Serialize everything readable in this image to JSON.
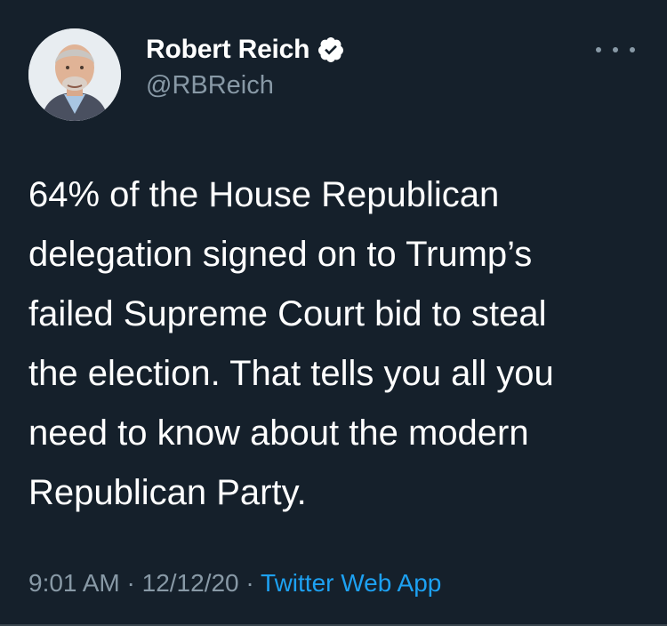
{
  "tweet": {
    "author": {
      "display_name": "Robert Reich",
      "handle": "@RBReich",
      "verified": true,
      "verified_icon": "verified-badge-icon",
      "avatar_icon": "avatar-photo"
    },
    "more_icon": "more-options-icon",
    "text": "64% of the House Republican\ndelegation signed on to Trump’s\nfailed Supreme Court bid to steal\nthe election. That tells you all you\nneed to know about the modern\nRepublican Party.",
    "time": "9:01 AM",
    "separator_1": " · ",
    "date": "12/12/20",
    "separator_2": " · ",
    "source": "Twitter Web App"
  },
  "colors": {
    "background": "#15202b",
    "text": "#ffffff",
    "secondary_text": "#8899a6",
    "link": "#1da1f2",
    "verified": "#ffffff"
  }
}
